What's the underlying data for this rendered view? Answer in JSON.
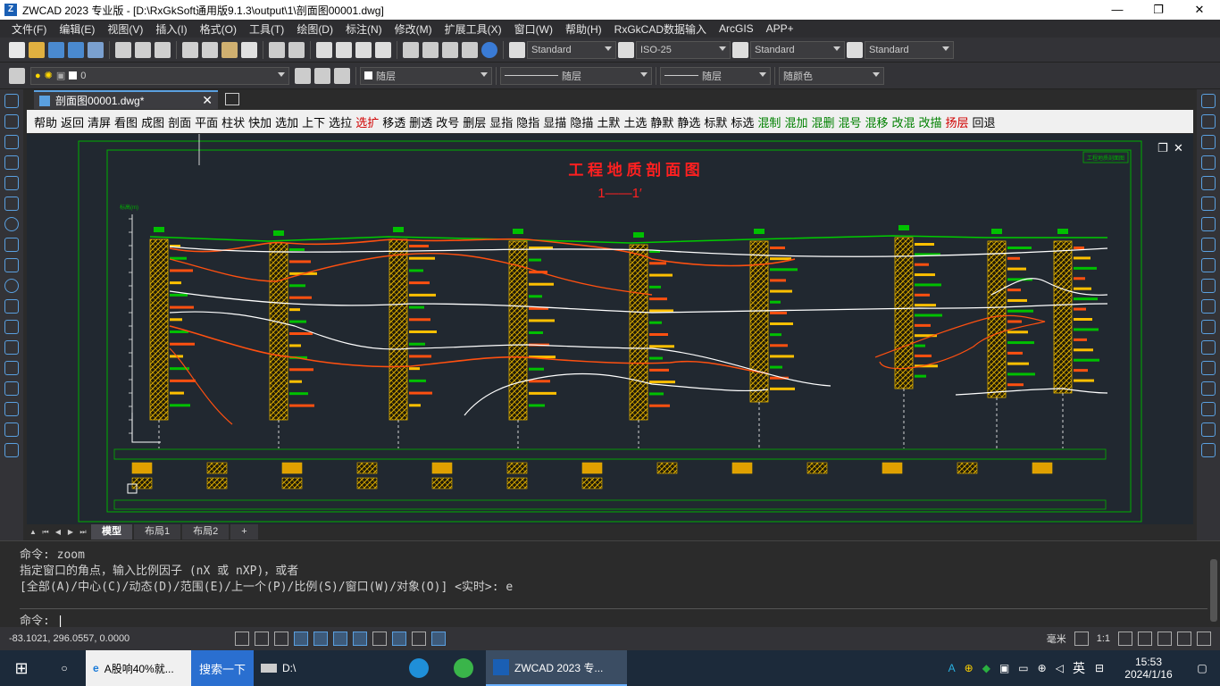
{
  "window": {
    "title": "ZWCAD 2023 专业版 - [D:\\RxGkSoft通用版9.1.3\\output\\1\\剖面图00001.dwg]",
    "minimize": "—",
    "restore": "❐",
    "close": "✕"
  },
  "menu": [
    "文件(F)",
    "编辑(E)",
    "视图(V)",
    "插入(I)",
    "格式(O)",
    "工具(T)",
    "绘图(D)",
    "标注(N)",
    "修改(M)",
    "扩展工具(X)",
    "窗口(W)",
    "帮助(H)",
    "RxGkCAD数据输入",
    "ArcGIS",
    "APP+"
  ],
  "toolbar1": {
    "text_style": "Standard",
    "dim_style": "ISO-25",
    "table_style": "Standard",
    "multileader_style": "Standard"
  },
  "toolbar2": {
    "layer": "0",
    "color": "随层",
    "linetype": "随层",
    "lineweight": "随层",
    "plotstyle": "随颜色"
  },
  "doc_tab": {
    "label": "剖面图00001.dwg*",
    "close": "✕"
  },
  "custom_commands": [
    {
      "label": "帮助",
      "color": "black"
    },
    {
      "label": "返回",
      "color": "black"
    },
    {
      "label": "清屏",
      "color": "black"
    },
    {
      "label": "看图",
      "color": "black"
    },
    {
      "label": "成图",
      "color": "black"
    },
    {
      "label": "剖面",
      "color": "black"
    },
    {
      "label": "平面",
      "color": "black"
    },
    {
      "label": "柱状",
      "color": "black"
    },
    {
      "label": "快加",
      "color": "black"
    },
    {
      "label": "选加",
      "color": "black"
    },
    {
      "label": "上下",
      "color": "black"
    },
    {
      "label": "选拉",
      "color": "black"
    },
    {
      "label": "选扩",
      "color": "red"
    },
    {
      "label": "移透",
      "color": "black"
    },
    {
      "label": "删透",
      "color": "black"
    },
    {
      "label": "改号",
      "color": "black"
    },
    {
      "label": "删层",
      "color": "black"
    },
    {
      "label": "显指",
      "color": "black"
    },
    {
      "label": "隐指",
      "color": "black"
    },
    {
      "label": "显描",
      "color": "black"
    },
    {
      "label": "隐描",
      "color": "black"
    },
    {
      "label": "土默",
      "color": "black"
    },
    {
      "label": "土选",
      "color": "black"
    },
    {
      "label": "静默",
      "color": "black"
    },
    {
      "label": "静选",
      "color": "black"
    },
    {
      "label": "标默",
      "color": "black"
    },
    {
      "label": "标选",
      "color": "black"
    },
    {
      "label": "混制",
      "color": "green"
    },
    {
      "label": "混加",
      "color": "green"
    },
    {
      "label": "混删",
      "color": "green"
    },
    {
      "label": "混号",
      "color": "green"
    },
    {
      "label": "混移",
      "color": "green"
    },
    {
      "label": "改混",
      "color": "green"
    },
    {
      "label": "改描",
      "color": "green"
    },
    {
      "label": "扬层",
      "color": "red"
    },
    {
      "label": "回退",
      "color": "black"
    }
  ],
  "drawing": {
    "title": "工 程 地 质 剖 面 图",
    "subtitle": "1——1′",
    "corner_label": "工程地质剖面图",
    "ylabel": "标高(m)"
  },
  "layout_tabs": [
    "模型",
    "布局1",
    "布局2",
    "+"
  ],
  "command_history": [
    "命令: zoom",
    "指定窗口的角点，输入比例因子 (nX 或 nXP)，或者",
    "[全部(A)/中心(C)/动态(D)/范围(E)/上一个(P)/比例(S)/窗口(W)/对象(O)] <实时>: e"
  ],
  "command_prompt": "命令:",
  "status": {
    "coords": "-83.1021, 296.0557, 0.0000",
    "units": "毫米",
    "scale": "1:1"
  },
  "taskbar": {
    "edge_tab": "A股响40%就...",
    "search_button": "搜索一下",
    "explorer": "D:\\",
    "app": "ZWCAD 2023 专...",
    "ime": "英",
    "time": "15:53",
    "date": "2024/1/16"
  }
}
